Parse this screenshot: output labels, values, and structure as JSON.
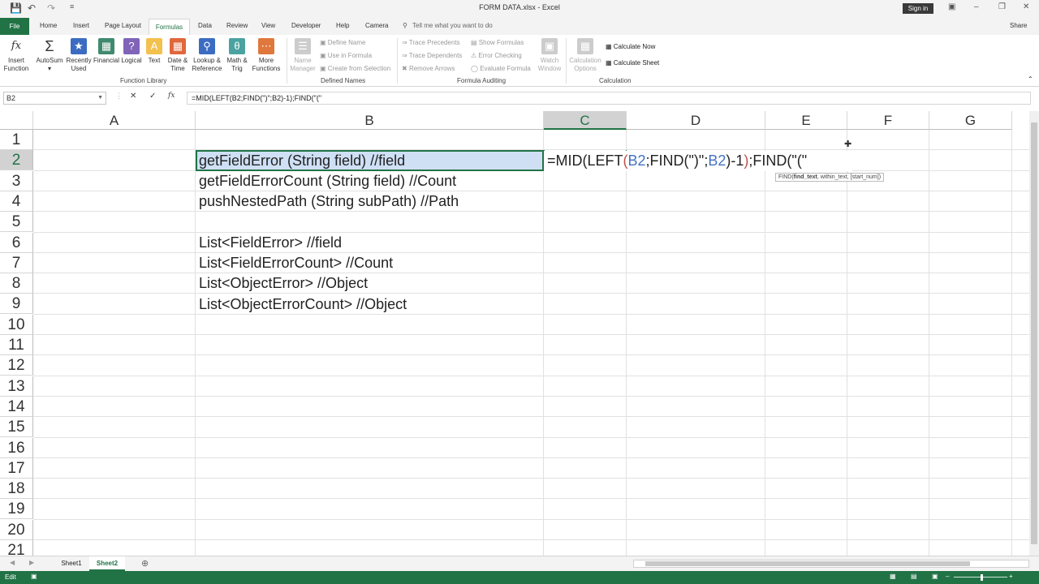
{
  "app": {
    "title": "FORM DATA.xlsx  -  Excel",
    "sign_in": "Sign in",
    "share": "Share",
    "tell_me": "Tell me what you want to do"
  },
  "tabs": [
    "File",
    "Home",
    "Insert",
    "Page Layout",
    "Formulas",
    "Data",
    "Review",
    "View",
    "Developer",
    "Help",
    "Camera"
  ],
  "ribbon": {
    "insert_function": [
      "Insert",
      "Function"
    ],
    "autosum": "AutoSum",
    "recently_used": [
      "Recently",
      "Used"
    ],
    "financial": "Financial",
    "logical": "Logical",
    "text": "Text",
    "date_time": [
      "Date &",
      "Time"
    ],
    "lookup": [
      "Lookup &",
      "Reference"
    ],
    "math": [
      "Math &",
      "Trig"
    ],
    "more": [
      "More",
      "Functions"
    ],
    "function_library": "Function Library",
    "name_manager": [
      "Name",
      "Manager"
    ],
    "define_name": "Define Name",
    "use_in_formula": "Use in Formula",
    "create_from_selection": "Create from Selection",
    "defined_names": "Defined Names",
    "trace_precedents": "Trace Precedents",
    "trace_dependents": "Trace Dependents",
    "remove_arrows": "Remove Arrows",
    "show_formulas": "Show Formulas",
    "error_checking": "Error Checking",
    "evaluate_formula": "Evaluate Formula",
    "watch_window": [
      "Watch",
      "Window"
    ],
    "formula_auditing": "Formula Auditing",
    "calc_options": [
      "Calculation",
      "Options"
    ],
    "calculate_now": "Calculate Now",
    "calculate_sheet": "Calculate Sheet",
    "calculation": "Calculation"
  },
  "formula_bar": {
    "name_box": "B2",
    "formula": "=MID(LEFT(B2;FIND(\")\";B2)-1);FIND(\"(\""
  },
  "columns": [
    "A",
    "B",
    "C",
    "D",
    "E",
    "F",
    "G"
  ],
  "rows": [
    "1",
    "2",
    "3",
    "4",
    "5",
    "6",
    "7",
    "8",
    "9",
    "10",
    "11",
    "12",
    "13",
    "14",
    "15",
    "16",
    "17",
    "18",
    "19",
    "20",
    "21"
  ],
  "cells": {
    "b2": "getFieldError (String field)  //field",
    "b3": "getFieldErrorCount (String field)  //Count",
    "b4": "pushNestedPath (String subPath)  //Path",
    "b6": "List<FieldError>  //field",
    "b7": "List<FieldErrorCount>  //Count",
    "b8": "List<ObjectError> //Object",
    "b9": "List<ObjectErrorCount> //Object"
  },
  "edit_formula": {
    "parts": [
      {
        "t": "=MID(LEFT",
        "c": "#222"
      },
      {
        "t": "(",
        "c": "#c0504d"
      },
      {
        "t": "B2",
        "c": "#4472c4"
      },
      {
        "t": ";FIND(",
        "c": "#222"
      },
      {
        "t": "\")\"",
        "c": "#222"
      },
      {
        "t": ";",
        "c": "#222"
      },
      {
        "t": "B2",
        "c": "#4472c4"
      },
      {
        "t": ")-1",
        "c": "#222"
      },
      {
        "t": ")",
        "c": "#c0504d"
      },
      {
        "t": ";FIND(\"(\"",
        "c": "#222"
      }
    ]
  },
  "tooltip": {
    "fn": "FIND(",
    "bold": "find_text",
    "rest": ", within_text, [start_num])"
  },
  "sheets": [
    "Sheet1",
    "Sheet2"
  ],
  "active_sheet": "Sheet2",
  "status": {
    "mode": "Edit"
  },
  "colors": {
    "accent": "#217346"
  }
}
